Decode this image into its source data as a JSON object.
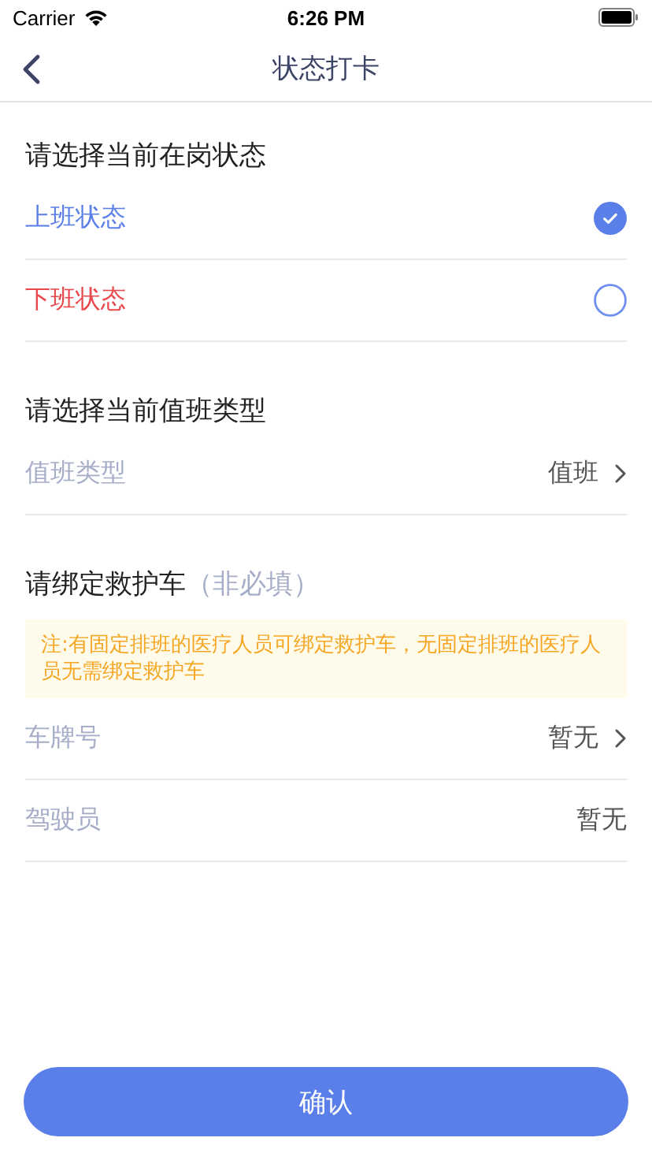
{
  "status_bar": {
    "carrier": "Carrier",
    "time": "6:26 PM"
  },
  "nav": {
    "title": "状态打卡"
  },
  "duty_status": {
    "heading": "请选择当前在岗状态",
    "options": [
      {
        "label": "上班状态",
        "color": "#5b7fe8",
        "selected": true
      },
      {
        "label": "下班状态",
        "color": "#e8484b",
        "selected": false
      }
    ]
  },
  "duty_type": {
    "heading": "请选择当前值班类型",
    "rows": [
      {
        "label": "值班类型",
        "value": "值班",
        "kind": "picker"
      }
    ]
  },
  "ambulance": {
    "heading": "请绑定救护车",
    "optional": "（非必填）",
    "notice": "注:有固定排班的医疗人员可绑定救护车，无固定排班的医疗人员无需绑定救护车",
    "rows": [
      {
        "label": "车牌号",
        "value": "暂无",
        "kind": "picker"
      },
      {
        "label": "驾驶员",
        "value": "暂无",
        "kind": "static"
      }
    ]
  },
  "confirm_button": "确认"
}
